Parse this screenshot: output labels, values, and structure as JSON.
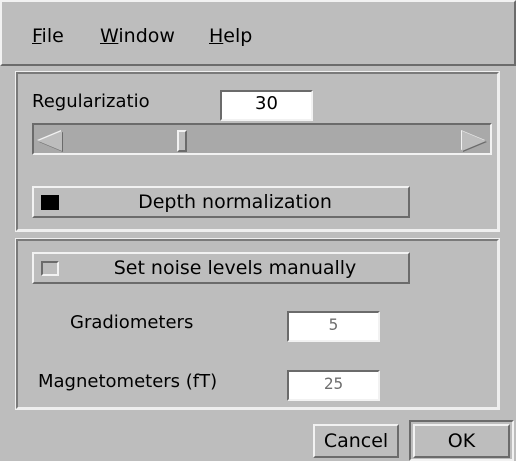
{
  "menu": {
    "file": {
      "mnemonic": "F",
      "rest": "ile"
    },
    "window": {
      "mnemonic": "W",
      "rest": "indow"
    },
    "help": {
      "mnemonic": "H",
      "rest": "elp"
    }
  },
  "regularization": {
    "label": "Regularizatio",
    "value": "30",
    "slider_fraction": 0.29,
    "depth_normalization": {
      "label": "Depth normalization",
      "checked": true
    }
  },
  "noise": {
    "manual_toggle": {
      "label": "Set noise levels manually",
      "checked": false
    },
    "gradiometers": {
      "label": "Gradiometers",
      "value": "5"
    },
    "magnetometers": {
      "label": "Magnetometers (fT)",
      "value": "25"
    }
  },
  "buttons": {
    "cancel": "Cancel",
    "ok": "OK"
  },
  "colors": {
    "background": "#bdbdbd",
    "field": "#ffffff",
    "trough": "#a9a9a9",
    "inactive_text": "#6f6f6f"
  }
}
